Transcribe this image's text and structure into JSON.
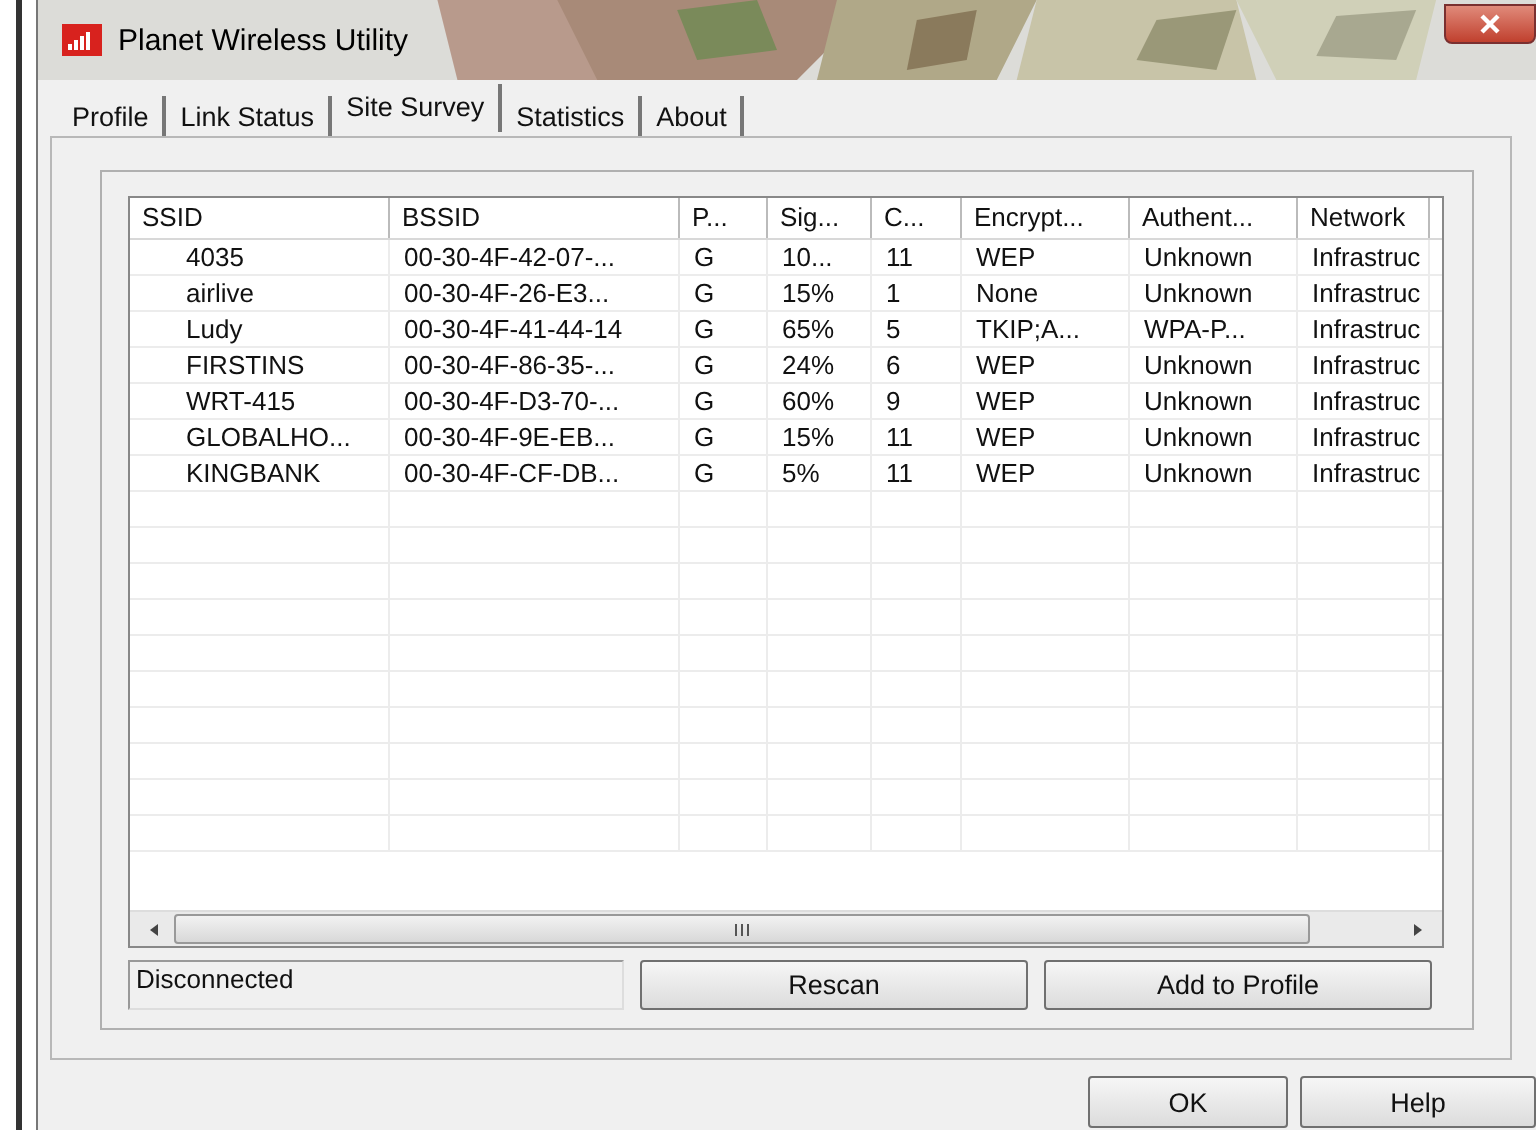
{
  "window": {
    "title": "Planet Wireless Utility"
  },
  "tabs": [
    {
      "label": "Profile",
      "selected": false
    },
    {
      "label": "Link Status",
      "selected": false
    },
    {
      "label": "Site Survey",
      "selected": true
    },
    {
      "label": "Statistics",
      "selected": false
    },
    {
      "label": "About",
      "selected": false
    }
  ],
  "table": {
    "columns": [
      "SSID",
      "BSSID",
      "P...",
      "Sig...",
      "C...",
      "Encrypt...",
      "Authent...",
      "Network"
    ],
    "rows": [
      [
        "4035",
        "00-30-4F-42-07-...",
        "G",
        "10...",
        "11",
        "WEP",
        "Unknown",
        "Infrastruc"
      ],
      [
        "airlive",
        "00-30-4F-26-E3...",
        "G",
        "15%",
        "1",
        "None",
        "Unknown",
        "Infrastruc"
      ],
      [
        "Ludy",
        "00-30-4F-41-44-14",
        "G",
        "65%",
        "5",
        "TKIP;A...",
        "WPA-P...",
        "Infrastruc"
      ],
      [
        "FIRSTINS",
        "00-30-4F-86-35-...",
        "G",
        "24%",
        "6",
        "WEP",
        "Unknown",
        "Infrastruc"
      ],
      [
        "WRT-415",
        "00-30-4F-D3-70-...",
        "G",
        "60%",
        "9",
        "WEP",
        "Unknown",
        "Infrastruc"
      ],
      [
        "GLOBALHO...",
        "00-30-4F-9E-EB...",
        "G",
        "15%",
        "11",
        "WEP",
        "Unknown",
        "Infrastruc"
      ],
      [
        "KINGBANK",
        "00-30-4F-CF-DB...",
        "G",
        "5%",
        "11",
        "WEP",
        "Unknown",
        "Infrastruc"
      ]
    ]
  },
  "status": "Disconnected",
  "actions": [
    "Rescan",
    "Add to Profile"
  ],
  "buttons": [
    "OK",
    "Help"
  ]
}
